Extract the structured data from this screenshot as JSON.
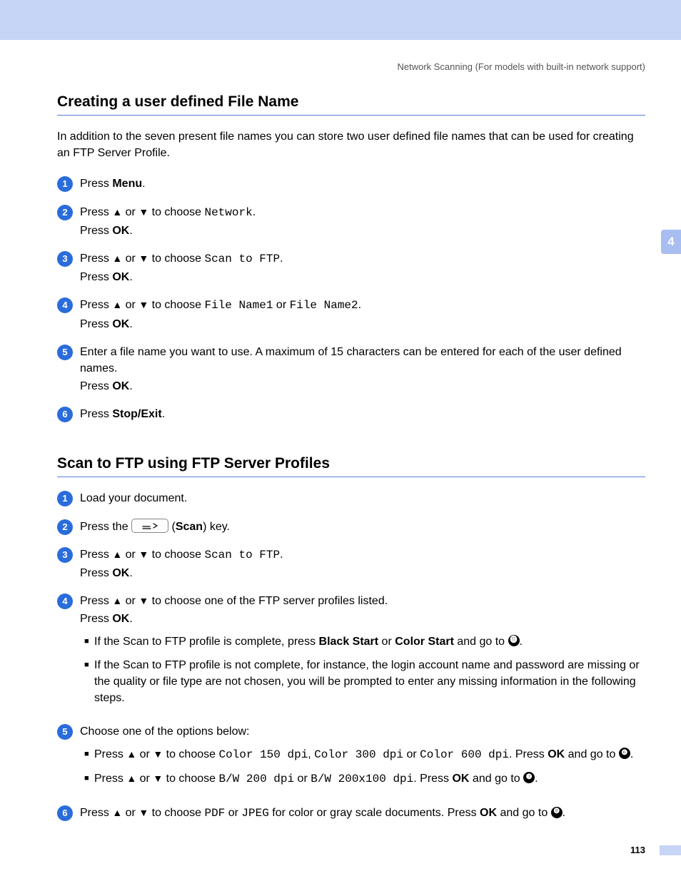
{
  "header": {
    "breadcrumb": "Network Scanning  (For models with built-in network support)"
  },
  "side_tab": "4",
  "page_number": "113",
  "section1": {
    "title": "Creating a user defined File Name",
    "intro": "In addition to the seven present file names you can store two user defined file names that can be used for creating an FTP Server Profile.",
    "steps": {
      "s1": {
        "n": "1",
        "press": "Press ",
        "menu": "Menu",
        "end": "."
      },
      "s2": {
        "n": "2",
        "press": "Press ",
        "or": " or ",
        "choose": " to choose ",
        "opt": "Network",
        "end": ".",
        "ok_line": "Press ",
        "ok": "OK",
        "ok_end": "."
      },
      "s3": {
        "n": "3",
        "press": "Press ",
        "or": " or ",
        "choose": " to choose ",
        "opt": "Scan to FTP",
        "end": ".",
        "ok_line": "Press ",
        "ok": "OK",
        "ok_end": "."
      },
      "s4": {
        "n": "4",
        "press": "Press ",
        "or": " or ",
        "choose": " to choose ",
        "opt1": "File Name1",
        "or2": " or ",
        "opt2": "File Name2",
        "end": ".",
        "ok_line": "Press ",
        "ok": "OK",
        "ok_end": "."
      },
      "s5": {
        "n": "5",
        "text": "Enter a file name you want to use. A maximum of 15 characters can be entered for each of the user defined names.",
        "ok_line": "Press ",
        "ok": "OK",
        "ok_end": "."
      },
      "s6": {
        "n": "6",
        "press": "Press ",
        "stop": "Stop/Exit",
        "end": "."
      }
    }
  },
  "section2": {
    "title": "Scan to FTP using FTP Server Profiles",
    "steps": {
      "s1": {
        "n": "1",
        "text": "Load your document."
      },
      "s2": {
        "n": "2",
        "pre": "Press the ",
        "paren_open": " (",
        "scan": "Scan",
        "post": ") key."
      },
      "s3": {
        "n": "3",
        "press": "Press ",
        "or": " or ",
        "choose": " to choose ",
        "opt": "Scan to FTP",
        "end": ".",
        "ok_line": "Press ",
        "ok": "OK",
        "ok_end": "."
      },
      "s4": {
        "n": "4",
        "press": "Press ",
        "or": " or ",
        "choose": " to choose one of the FTP server profiles listed.",
        "ok_line": "Press ",
        "ok": "OK",
        "ok_end": ".",
        "b1_pre": "If the Scan to FTP profile is complete, press ",
        "b1_bs": "Black Start",
        "b1_or": " or ",
        "b1_cs": "Color Start",
        "b1_goto": " and go to ",
        "b1_ref": "⓫",
        "b1_end": ".",
        "b2": "If the Scan to FTP profile is not complete, for instance, the login account name and password are missing or the quality or file type are not chosen, you will be prompted to enter any missing information in the following steps."
      },
      "s5": {
        "n": "5",
        "text": "Choose one of the options below:",
        "b1_press": "Press ",
        "b1_or": " or ",
        "b1_choose": " to choose ",
        "b1_o1": "Color 150 dpi",
        "b1_c1": ", ",
        "b1_o2": "Color 300 dpi",
        "b1_or2": " or ",
        "b1_o3": "Color 600 dpi",
        "b1_post": ". Press ",
        "b1_ok": "OK",
        "b1_goto": " and go to ",
        "b1_ref": "❻",
        "b1_end": ".",
        "b2_press": "Press ",
        "b2_or": " or ",
        "b2_choose": " to choose ",
        "b2_o1": "B/W 200 dpi",
        "b2_or2": " or ",
        "b2_o2": "B/W 200x100 dpi",
        "b2_post": ". Press ",
        "b2_ok": "OK",
        "b2_goto": " and go to ",
        "b2_ref": "❼",
        "b2_end": "."
      },
      "s6": {
        "n": "6",
        "press": "Press ",
        "or": " or ",
        "choose": " to choose ",
        "o1": "PDF",
        "or2": " or ",
        "o2": "JPEG",
        "post": " for color or gray scale documents. Press ",
        "ok": "OK",
        "goto": " and go to ",
        "ref": "❽",
        "end": "."
      }
    }
  }
}
